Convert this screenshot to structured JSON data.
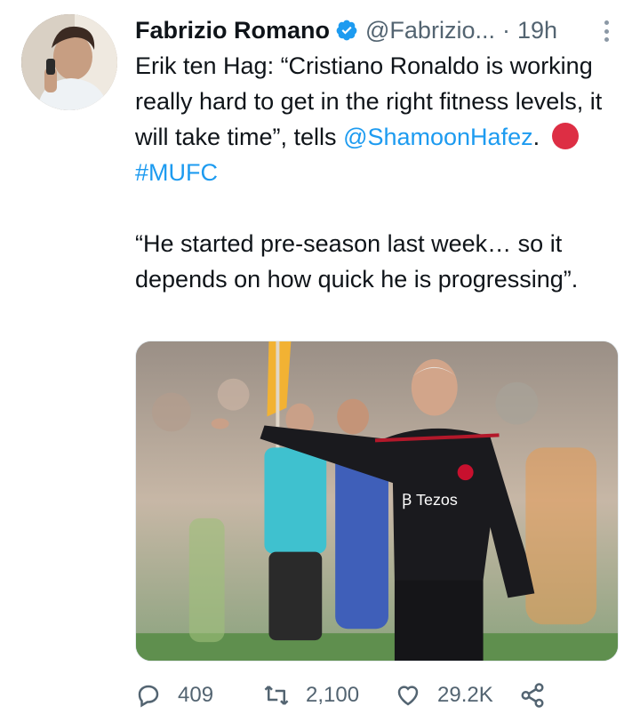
{
  "tweet": {
    "author_name": "Fabrizio Romano",
    "handle": "@Fabrizio...",
    "separator": "·",
    "time": "19h",
    "text": {
      "line1": "Erik ten Hag: “Cristiano Ronaldo is working really hard to get in the right fitness levels, it will take time”, tells ",
      "mention": "@ShamoonHafez",
      "after_mention": ". ",
      "hashtag": "#MUFC",
      "quote": "“He started pre-season last week… so it depends on how quick he is progressing”."
    },
    "media_icon": "photo-of-coach-pointing",
    "stats": {
      "replies": "409",
      "retweets": "2,100",
      "likes": "29.2K"
    },
    "icons": {
      "verified": "verified-badge-icon",
      "reply": "reply-icon",
      "retweet": "retweet-icon",
      "like": "heart-icon",
      "share": "share-icon",
      "more": "more-icon"
    },
    "colors": {
      "link": "#1d9bf0",
      "secondary_text": "#536471",
      "red_circle": "#dd2e44"
    }
  }
}
